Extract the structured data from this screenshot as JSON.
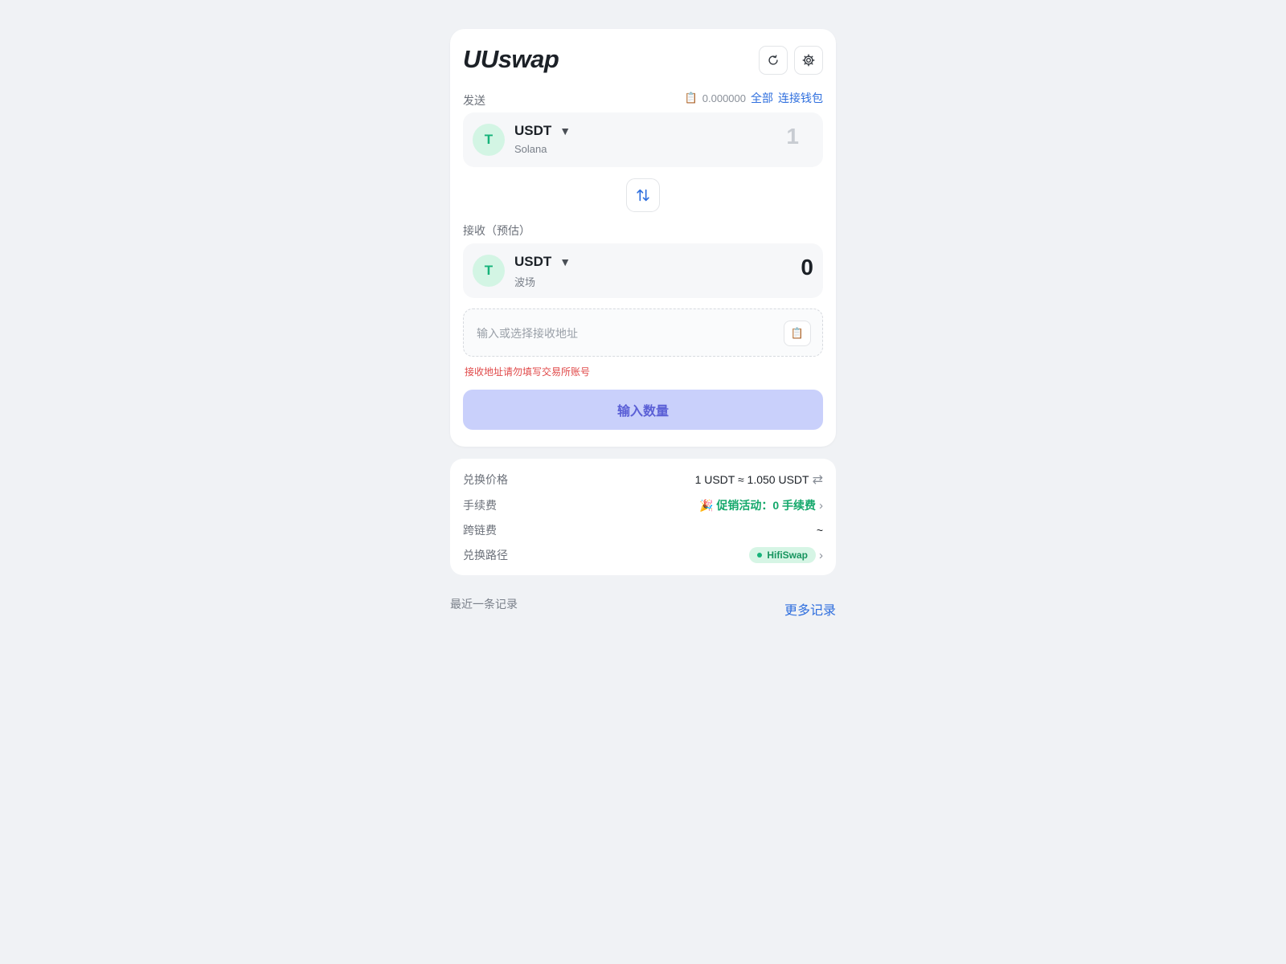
{
  "app": {
    "title": "UUswap"
  },
  "send": {
    "label": "发送",
    "balance": "0.000000",
    "all_label": "全部",
    "connect_label": "连接钱包",
    "token": {
      "avatar": "T",
      "symbol": "USDT",
      "chain": "Solana"
    },
    "amount_placeholder": "1"
  },
  "receive": {
    "label": "接收（预估）",
    "token": {
      "avatar": "T",
      "symbol": "USDT",
      "chain": "波场"
    },
    "amount": "0"
  },
  "address": {
    "placeholder": "输入或选择接收地址",
    "warning": "接收地址请勿填写交易所账号"
  },
  "main_button": {
    "label": "输入数量"
  },
  "details": {
    "rate_label": "兑换价格",
    "rate_value": "1 USDT ≈ 1.050 USDT",
    "fee_label": "手续费",
    "fee_value": "🎉 促销活动：0 手续费",
    "bridge_fee_label": "跨链费",
    "bridge_fee_value": "~",
    "route_label": "兑换路径",
    "route_value": "HifiSwap"
  },
  "history": {
    "recent_label": "最近一条记录",
    "more_label": "更多记录"
  },
  "icons": {
    "refresh": "refresh-icon",
    "settings": "gear-icon",
    "clipboard": "clipboard-icon",
    "swap": "swap-vertical-icon",
    "caret": "caret-down-icon"
  },
  "colors": {
    "accent_blue": "#2f6fde",
    "button_bg": "#c9d0fb",
    "button_text": "#5a5fd6",
    "token_avatar_bg": "#d3f5e4",
    "token_avatar_text": "#16b37a",
    "promo_green": "#14a86b",
    "warning_red": "#e04848"
  }
}
